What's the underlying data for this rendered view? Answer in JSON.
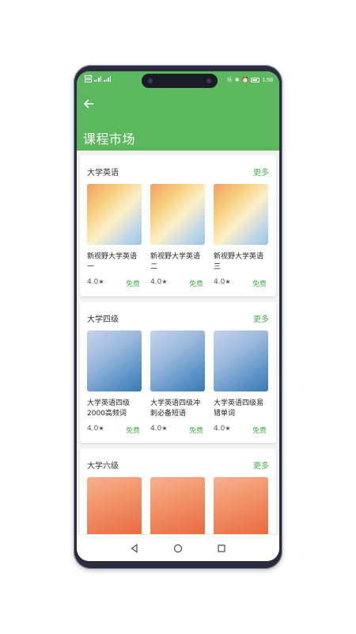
{
  "status_bar": {
    "time": "1:58",
    "sim1": "HD",
    "sim2": "HD",
    "network": "4G"
  },
  "header": {
    "back_icon": "arrow-left-icon",
    "title": "课程市场",
    "color": "#5cb85f"
  },
  "sections": [
    {
      "title": "大学英语",
      "more": "更多",
      "items": [
        {
          "name": "新视野大学英语一",
          "rating": "4.0",
          "price": "免费",
          "theme": "warm"
        },
        {
          "name": "新视野大学英语二",
          "rating": "4.0",
          "price": "免费",
          "theme": "warm"
        },
        {
          "name": "新视野大学英语三",
          "rating": "4.0",
          "price": "免费",
          "theme": "warm"
        }
      ]
    },
    {
      "title": "大学四级",
      "more": "更多",
      "items": [
        {
          "name": "大学英语四级2000高频词",
          "rating": "4.0",
          "price": "免费",
          "theme": "blue"
        },
        {
          "name": "大学英语四级冲刺必备短语",
          "rating": "4.0",
          "price": "免费",
          "theme": "blue"
        },
        {
          "name": "大学英语四级易错单词",
          "rating": "4.0",
          "price": "免费",
          "theme": "blue"
        }
      ]
    },
    {
      "title": "大学六级",
      "more": "更多",
      "items": [
        {
          "name": "",
          "rating": "",
          "price": "",
          "theme": "orange"
        },
        {
          "name": "",
          "rating": "",
          "price": "",
          "theme": "orange"
        },
        {
          "name": "",
          "rating": "",
          "price": "",
          "theme": "orange"
        }
      ]
    }
  ],
  "star_icon": "star-icon",
  "nav": {
    "back": "back-triangle-icon",
    "home": "home-circle-icon",
    "recents": "recents-square-icon"
  },
  "accent_color": "#4caf50"
}
